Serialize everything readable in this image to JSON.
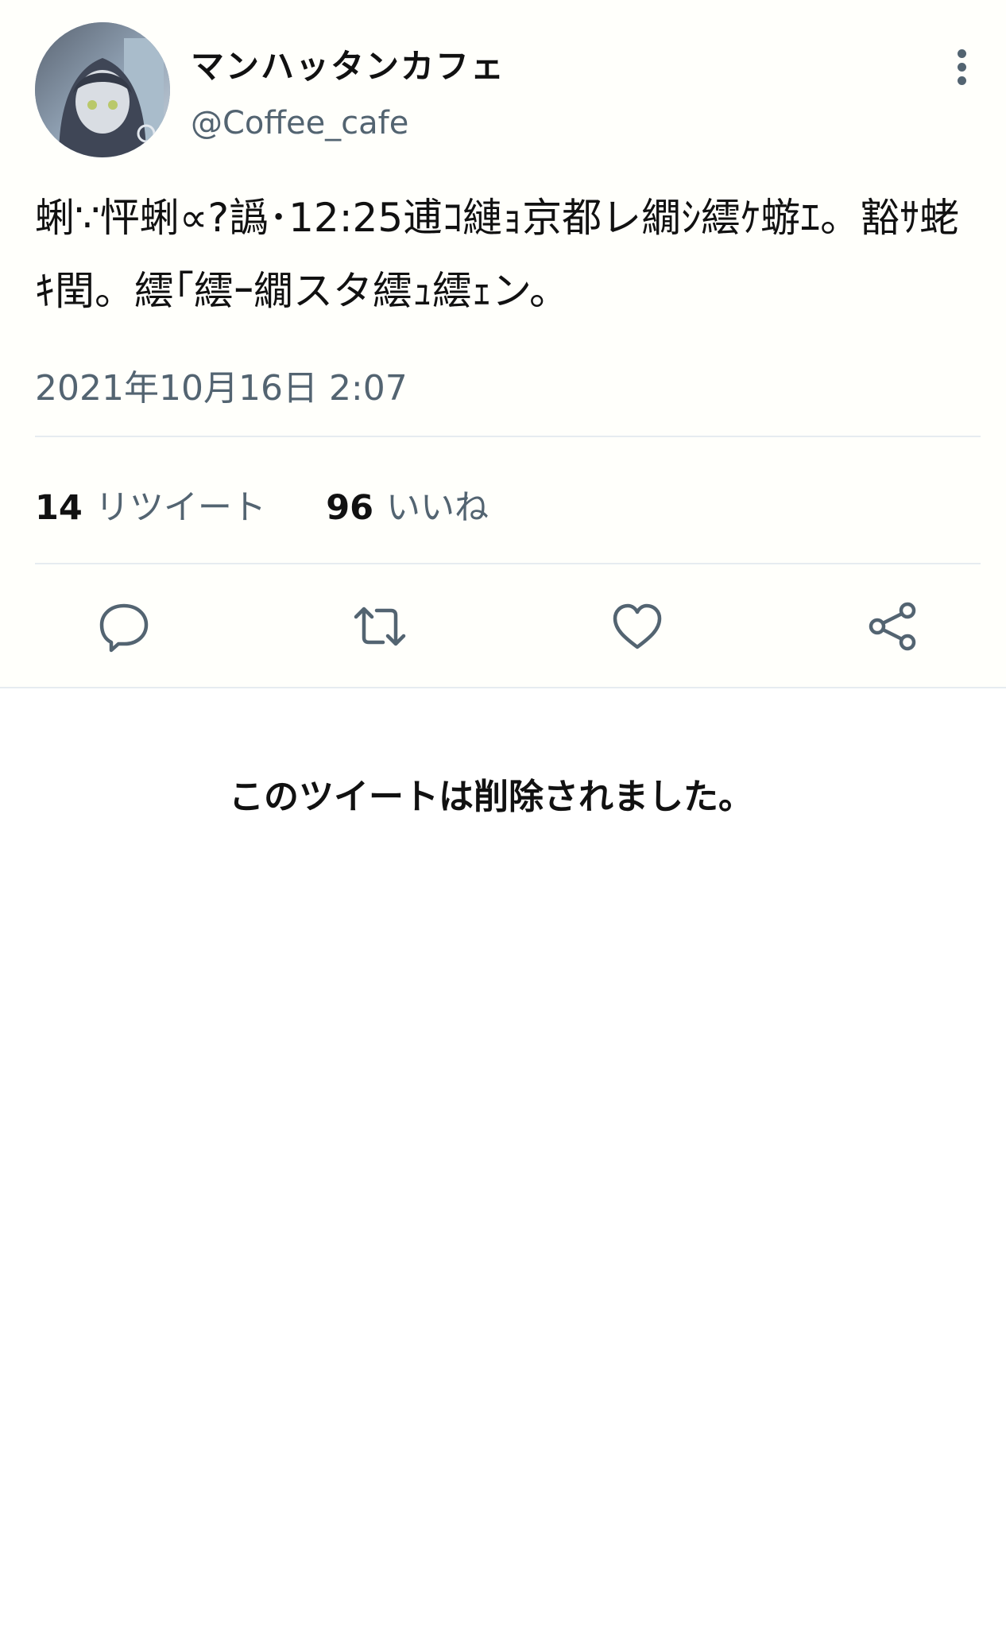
{
  "tweet": {
    "display_name": "マンハッタンカフェ",
    "handle": "@Coffee_cafe",
    "text": "蜊∵怦蜊∝?譌･12:25逋ｺ縺ｮ京都レ繝ｼ繧ｹ蝣ｴ。豁ｻ蛯ｷ閏。繧｢繧ｰ繝スタ繧ｭ繧ｪン。",
    "timestamp": "2021年10月16日 2:07",
    "stats": {
      "retweets_count": "14",
      "retweets_label": "リツイート",
      "likes_count": "96",
      "likes_label": "いいね"
    }
  },
  "icons": {
    "more": "more-vertical-icon",
    "reply": "reply-icon",
    "retweet": "retweet-icon",
    "like": "heart-icon",
    "share": "share-icon"
  },
  "colors": {
    "text": "#111111",
    "secondary": "#536471",
    "divider": "#e6ecf0",
    "background": "#fffffb"
  },
  "deleted_notice": "このツイートは削除されました。"
}
